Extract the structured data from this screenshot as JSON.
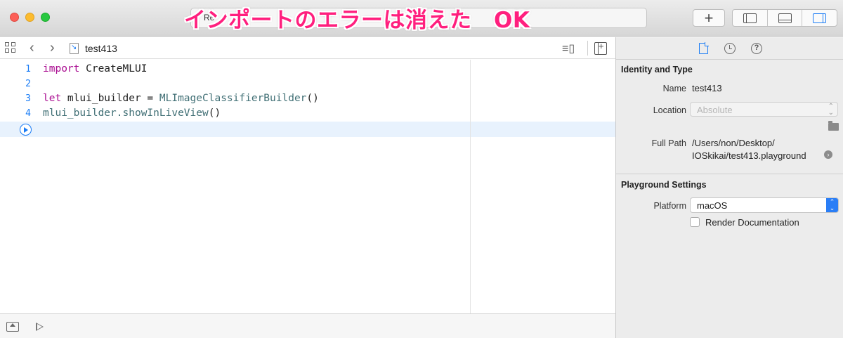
{
  "window": {
    "activity_text": "Re",
    "caption_overlay": "インポートのエラーは消えた　OK",
    "add_button": "+"
  },
  "jumpbar": {
    "file_name": "test413"
  },
  "editor": {
    "lines": [
      {
        "num": "1",
        "kw": "import",
        "rest": " CreateMLUI"
      },
      {
        "num": "2"
      },
      {
        "num": "3",
        "kw": "let",
        "rest1": " mlui_builder = ",
        "type": "MLImageClassifierBuilder",
        "rest2": "()"
      },
      {
        "num": "4",
        "obj": "mlui_builder.",
        "method": "showInLiveView",
        "rest": "()"
      }
    ]
  },
  "inspector": {
    "identity": {
      "title": "Identity and Type",
      "name_label": "Name",
      "name_value": "test413",
      "location_label": "Location",
      "location_value": "Absolute",
      "fullpath_label": "Full Path",
      "fullpath_line1": "/Users/non/Desktop/",
      "fullpath_line2": "IOSkikai/test413.playground"
    },
    "playground": {
      "title": "Playground Settings",
      "platform_label": "Platform",
      "platform_value": "macOS",
      "render_doc_label": "Render Documentation",
      "render_doc_checked": false
    }
  },
  "colors": {
    "keyword": "#aa0d91",
    "type": "#3f6e74",
    "line_number": "#1a7cf5",
    "caption": "#ff1f7e",
    "accent": "#1a7cf5"
  }
}
